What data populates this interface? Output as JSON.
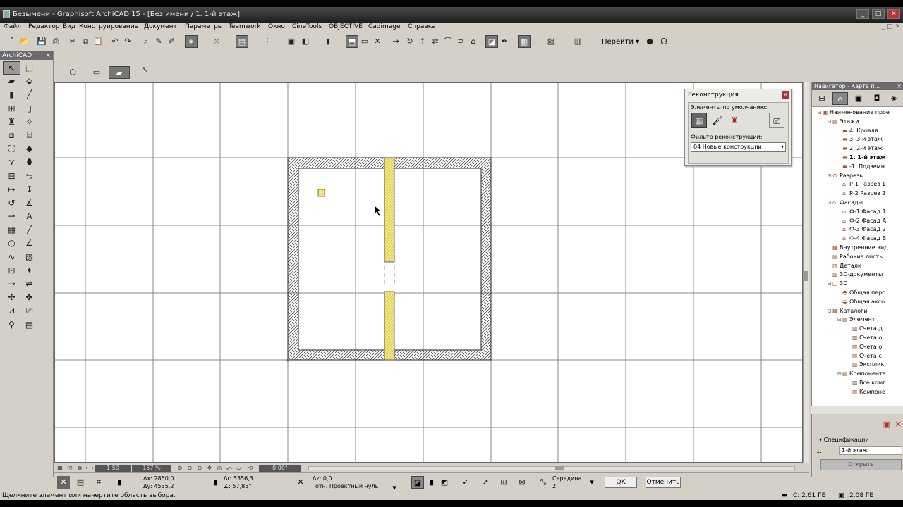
{
  "window": {
    "title": "Безымени - Graphisoft ArchiCAD 15 - [Без имени / 1. 1-й этаж]"
  },
  "menu": [
    "Файл",
    "Редактор",
    "Вид",
    "Конструирование",
    "Документ",
    "Параметры",
    "Teamwork",
    "Окно",
    "CineTools",
    "OBJECTIVE",
    "Cadimage",
    "Справка"
  ],
  "toolbar": {
    "goto_label": "Перейти"
  },
  "toolbox": {
    "title": "ArchiCAD"
  },
  "reconstruction_palette": {
    "title": "Реконструкция",
    "defaults_label": "Элементы по умолчанию:",
    "filter_label": "Фильтр реконструкции:",
    "filter_value": "04 Новые конструкции"
  },
  "navigator": {
    "title": "Навигатор - Карта п...",
    "tree": [
      {
        "label": "Наименование прое",
        "level": 0,
        "toggle": "−",
        "icon": "folder"
      },
      {
        "label": "Этажи",
        "level": 1,
        "toggle": "−",
        "icon": "stories"
      },
      {
        "label": "4. Кровля",
        "level": 2,
        "toggle": "",
        "icon": "story"
      },
      {
        "label": "3. 3-й этаж",
        "level": 2,
        "toggle": "",
        "icon": "story"
      },
      {
        "label": "2. 2-й этаж",
        "level": 2,
        "toggle": "",
        "icon": "story"
      },
      {
        "label": "1. 1-й этаж",
        "level": 2,
        "toggle": "",
        "icon": "story",
        "bold": true
      },
      {
        "label": "-1. Подземн",
        "level": 2,
        "toggle": "",
        "icon": "story"
      },
      {
        "label": "Разрезы",
        "level": 1,
        "toggle": "−",
        "icon": "sections"
      },
      {
        "label": "Р-1 Разрез 1",
        "level": 2,
        "toggle": "",
        "icon": "section"
      },
      {
        "label": "Р-2 Разрез 2",
        "level": 2,
        "toggle": "",
        "icon": "section"
      },
      {
        "label": "Фасады",
        "level": 1,
        "toggle": "−",
        "icon": "elevations"
      },
      {
        "label": "Ф-1 Фасад 1",
        "level": 2,
        "toggle": "",
        "icon": "elevation"
      },
      {
        "label": "Ф-2 Фасад А",
        "level": 2,
        "toggle": "",
        "icon": "elevation"
      },
      {
        "label": "Ф-3 Фасад 2",
        "level": 2,
        "toggle": "",
        "icon": "elevation"
      },
      {
        "label": "Ф-4 Фасад Б",
        "level": 2,
        "toggle": "",
        "icon": "elevation"
      },
      {
        "label": "Внутренние вид",
        "level": 1,
        "toggle": "",
        "icon": "interior"
      },
      {
        "label": "Рабочие листы",
        "level": 1,
        "toggle": "",
        "icon": "worksheet"
      },
      {
        "label": "Детали",
        "level": 1,
        "toggle": "",
        "icon": "detail"
      },
      {
        "label": "3D-документы",
        "level": 1,
        "toggle": "",
        "icon": "doc3d"
      },
      {
        "label": "3D",
        "level": 1,
        "toggle": "−",
        "icon": "3d"
      },
      {
        "label": "Общая перс",
        "level": 2,
        "toggle": "",
        "icon": "persp"
      },
      {
        "label": "Общая аксо",
        "level": 2,
        "toggle": "",
        "icon": "axo"
      },
      {
        "label": "Каталоги",
        "level": 1,
        "toggle": "−",
        "icon": "lists"
      },
      {
        "label": "Элемент",
        "level": 2,
        "toggle": "−",
        "icon": "list"
      },
      {
        "label": "Счета д",
        "level": 3,
        "toggle": "",
        "icon": "table"
      },
      {
        "label": "Счета о",
        "level": 3,
        "toggle": "",
        "icon": "table"
      },
      {
        "label": "Счета о",
        "level": 3,
        "toggle": "",
        "icon": "table"
      },
      {
        "label": "Счета с",
        "level": 3,
        "toggle": "",
        "icon": "table"
      },
      {
        "label": "Экспликг",
        "level": 3,
        "toggle": "",
        "icon": "table"
      },
      {
        "label": "Компонента",
        "level": 2,
        "toggle": "−",
        "icon": "list"
      },
      {
        "label": "Все комг",
        "level": 3,
        "toggle": "",
        "icon": "table"
      },
      {
        "label": "Компоне",
        "level": 3,
        "toggle": "",
        "icon": "table"
      }
    ],
    "specs_label": "Спецификации",
    "field_index": "1.",
    "field_value": "1-й этаж",
    "open_button": "Открыть"
  },
  "zoom_bar": {
    "scale": "1:50",
    "zoom": "157 %",
    "angle": "0,00°"
  },
  "info": {
    "dx": "Δх: 2850,0",
    "dy": "Δу: 4535,2",
    "dr": "Δr: 5356,3",
    "angle": "∡: 57,85°",
    "dz": "Δz: 0,0",
    "ref": "отн. Проектный нуль",
    "snap": "Середина",
    "snap_n": "2",
    "ok": "OK",
    "cancel": "Отменить"
  },
  "status": {
    "hint": "Щелкните элемент или начертите область выбора.",
    "disk_c": "C: 2.61 ГБ",
    "mem": "2.08 ГБ"
  },
  "colors": {
    "wall_yellow": "#f2e47a",
    "hatch": "#333333",
    "grid": "#888888",
    "titlebar": "#2b2b2b"
  },
  "icons": [
    "arrow-icon",
    "marquee-icon",
    "wall-icon",
    "column-icon",
    "beam-icon",
    "door-icon",
    "window-icon",
    "slab-icon",
    "roof-icon",
    "mesh-icon",
    "text-icon",
    "line-icon",
    "circle-icon",
    "arc-icon",
    "spline-icon",
    "figure-icon",
    "camera-icon",
    "lamp-icon",
    "zone-icon",
    "dimension-icon",
    "label-icon",
    "stairs-icon"
  ]
}
